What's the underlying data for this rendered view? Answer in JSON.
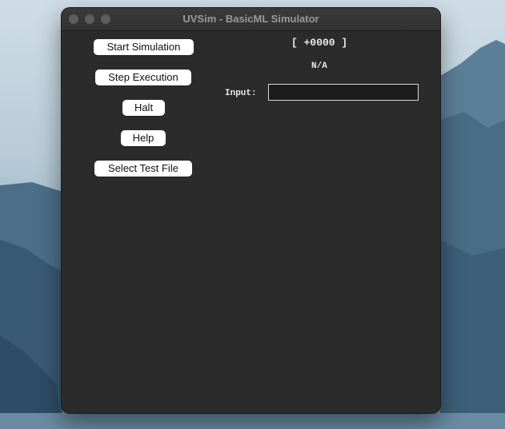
{
  "window": {
    "title": "UVSim - BasicML Simulator"
  },
  "controls": {
    "start_label": "Start Simulation",
    "step_label": "Step Execution",
    "halt_label": "Halt",
    "help_label": "Help",
    "select_file_label": "Select Test File"
  },
  "display": {
    "accumulator": "[ +0000 ]",
    "status": "N/A",
    "input_label": "Input:",
    "input_value": ""
  },
  "colors": {
    "window_bg": "#2b2b2b",
    "button_bg": "#ffffff",
    "text": "#eaeaea",
    "traffic_light": "#5e5e5e"
  }
}
